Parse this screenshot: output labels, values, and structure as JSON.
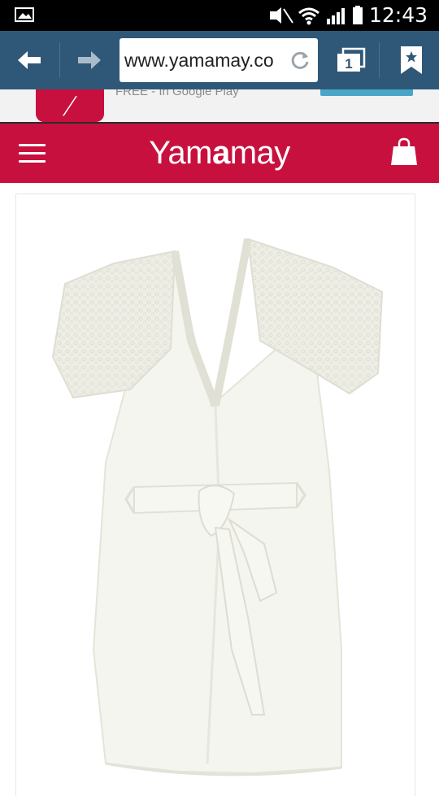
{
  "status_bar": {
    "time": "12:43",
    "icons": [
      "gallery-icon",
      "mute-icon",
      "wifi-icon",
      "signal-icon",
      "battery-icon"
    ]
  },
  "browser": {
    "url": "www.yamamay.co",
    "icons": [
      "back-arrow-icon",
      "forward-arrow-icon",
      "reload-icon",
      "tabs-icon",
      "bookmark-icon"
    ],
    "tab_count": "1",
    "toolbar_color": "#2f5878"
  },
  "app_banner": {
    "store_text": "FREE - In Google Play",
    "icon_letter": "/"
  },
  "site_header": {
    "brand_prefix": "Yam",
    "brand_bold": "a",
    "brand_suffix": "may",
    "brand_color": "#c8103f",
    "icons": [
      "hamburger-menu-icon",
      "shopping-bag-icon"
    ]
  },
  "product": {
    "image_subject": "white satin robe with lace collar and tie belt"
  }
}
